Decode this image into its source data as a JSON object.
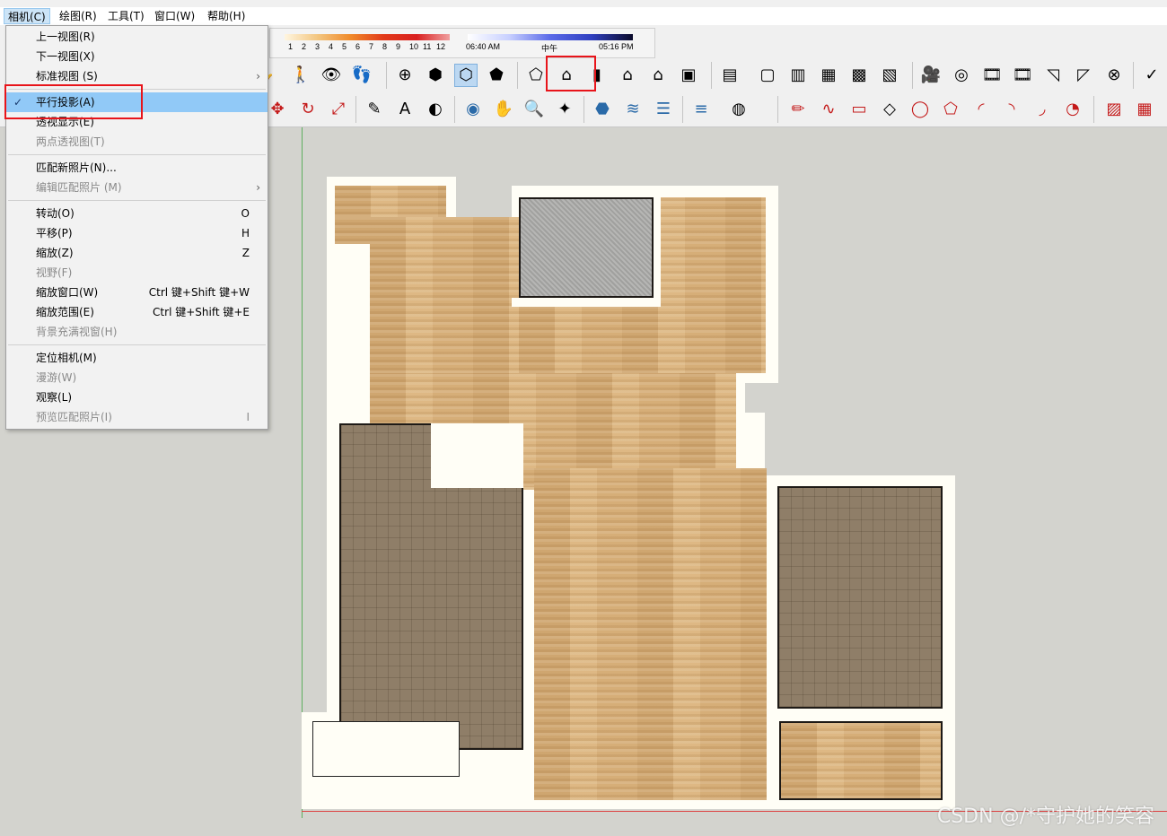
{
  "menubar": {
    "items": [
      "相机(C)",
      "绘图(R)",
      "工具(T)",
      "窗口(W)",
      "帮助(H)"
    ]
  },
  "shadow_panel": {
    "months": [
      "1",
      "2",
      "3",
      "4",
      "5",
      "6",
      "7",
      "8",
      "9",
      "10",
      "11",
      "12"
    ],
    "time_start": "06:40 AM",
    "time_mid": "中午",
    "time_end": "05:16 PM"
  },
  "camera_menu": {
    "items": [
      {
        "label": "上一视图(R)",
        "shortcut": "",
        "disabled": false
      },
      {
        "label": "下一视图(X)",
        "shortcut": "",
        "disabled": false
      },
      {
        "label": "标准视图 (S)",
        "submenu": "›",
        "disabled": false
      },
      {
        "label": "平行投影(A)",
        "checked": "✓",
        "disabled": false
      },
      {
        "label": "透视显示(E)",
        "shortcut": "",
        "disabled": false
      },
      {
        "label": "两点透视图(T)",
        "shortcut": "",
        "disabled": true
      },
      {
        "label": "匹配新照片(N)...",
        "shortcut": "",
        "disabled": false
      },
      {
        "label": "编辑匹配照片 (M)",
        "submenu": "›",
        "disabled": true
      },
      {
        "label": "转动(O)",
        "shortcut": "O",
        "disabled": false
      },
      {
        "label": "平移(P)",
        "shortcut": "H",
        "disabled": false
      },
      {
        "label": "缩放(Z)",
        "shortcut": "Z",
        "disabled": false
      },
      {
        "label": "视野(F)",
        "shortcut": "",
        "disabled": true
      },
      {
        "label": "缩放窗口(W)",
        "shortcut": "Ctrl 键+Shift 键+W",
        "disabled": false
      },
      {
        "label": "缩放范围(E)",
        "shortcut": "Ctrl 键+Shift 键+E",
        "disabled": false
      },
      {
        "label": "背景充满视窗(H)",
        "shortcut": "",
        "disabled": true
      },
      {
        "label": "定位相机(M)",
        "shortcut": "",
        "disabled": false
      },
      {
        "label": "漫游(W)",
        "shortcut": "",
        "disabled": true
      },
      {
        "label": "观察(L)",
        "shortcut": "",
        "disabled": false
      },
      {
        "label": "预览匹配照片(I)",
        "shortcut": "I",
        "disabled": true
      }
    ]
  },
  "toolbar_row1_icons": [
    "hand-icon",
    "person-icon",
    "eye-icon",
    "footprints-icon",
    "section-plane-icon",
    "iso-view-icon",
    "top-view-icon",
    "front-view-icon",
    "right-view-icon",
    "back-view-icon",
    "left-view-icon",
    "bottom-view-icon",
    "house-view-icon",
    "xray-icon",
    "back-edges-icon",
    "wireframe-icon",
    "hidden-line-icon",
    "shaded-icon",
    "textured-icon",
    "monochrome-icon",
    "camera-icon",
    "match-photo-icon",
    "walk-icon",
    "look-around-icon",
    "section-fill-icon",
    "section-cut-icon",
    "no-entry-icon",
    "check-icon"
  ],
  "toolbar_row2_icons": [
    "move-icon",
    "rotate-icon",
    "scale-icon",
    "tape-icon",
    "text-icon",
    "paint-icon",
    "orbit-icon",
    "pan-icon",
    "zoom-icon",
    "zoom-extents-icon",
    "components-icon",
    "layers-icon",
    "styles-icon",
    "outliner-icon",
    "user-icon",
    "pencil-icon",
    "freehand-icon",
    "rectangle-icon",
    "rotated-rect-icon",
    "circle-icon",
    "polygon-icon",
    "arc-icon",
    "two-point-arc-icon",
    "three-point-arc-icon",
    "pie-icon",
    "sandbox-icon",
    "grid-icon"
  ],
  "watermark": "CSDN @/*守护她的笑容",
  "colors": {
    "accent_red": "#e8141a",
    "menu_highlight": "#91c9f7"
  }
}
